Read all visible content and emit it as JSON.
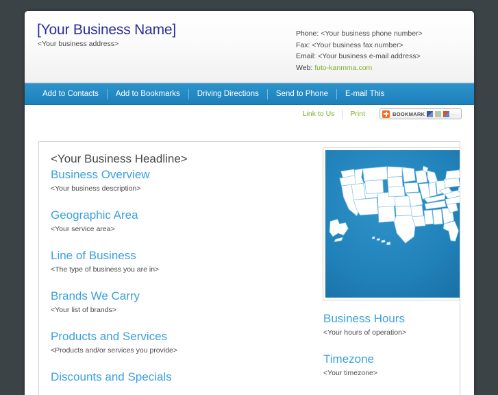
{
  "header": {
    "business_name": "[Your Business Name]",
    "business_address": "<Your business address>",
    "contact": {
      "phone_label": "Phone:",
      "phone_value": "<Your business phone number>",
      "fax_label": "Fax:",
      "fax_value": "<Your business fax number>",
      "email_label": "Email:",
      "email_value": "<Your business e-mail address>",
      "web_label": "Web:",
      "web_value": "futo-kanmma.com"
    }
  },
  "nav": {
    "items": [
      {
        "label": "Add to Contacts"
      },
      {
        "label": "Add to Bookmarks"
      },
      {
        "label": "Driving Directions"
      },
      {
        "label": "Send to Phone"
      },
      {
        "label": "E-mail This"
      }
    ]
  },
  "utilbar": {
    "link_to_us": "Link to Us",
    "print": "Print",
    "bookmark_label": "BOOKMARK",
    "bookmark_dots": "..."
  },
  "main": {
    "headline": "<Your Business Headline>",
    "left_sections": [
      {
        "title": "Business Overview",
        "body": "<Your business description>"
      },
      {
        "title": "Geographic Area",
        "body": "<Your service area>"
      },
      {
        "title": "Line of Business",
        "body": "<The type of business you are in>"
      },
      {
        "title": "Brands We Carry",
        "body": "<Your list of brands>"
      },
      {
        "title": "Products and Services",
        "body": "<Products and/or services you provide>"
      },
      {
        "title": "Discounts and Specials",
        "body": ""
      }
    ],
    "map_alt": "united-states-map",
    "right_sections": [
      {
        "title": "Business Hours",
        "body": "<Your hours of operation>"
      },
      {
        "title": "Timezone",
        "body": "<Your timezone>"
      }
    ]
  },
  "colors": {
    "page_background": "#3c4347",
    "nav_blue": "#2389c4",
    "heading_blue": "#3aa0e0",
    "link_green": "#7fb02a",
    "business_name_blue": "#2d2d99",
    "bookmark_orange": "#f26c21"
  }
}
